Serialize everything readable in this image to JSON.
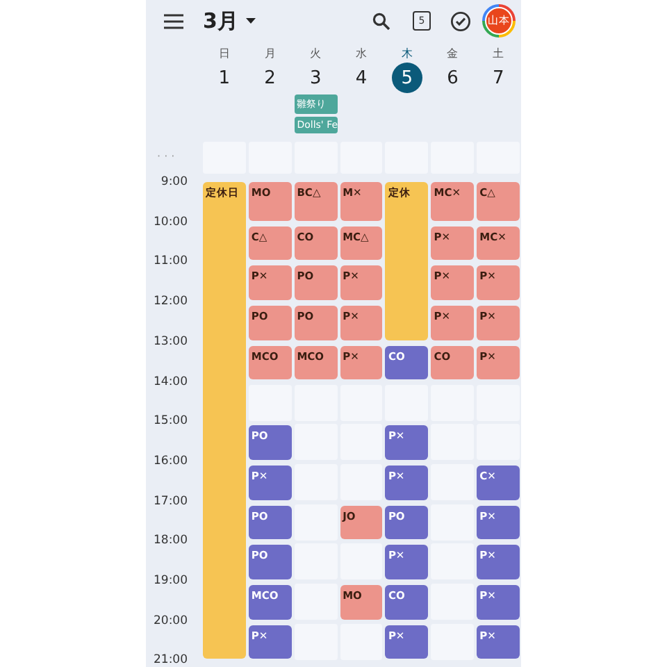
{
  "header": {
    "month": "3月",
    "calendar_day": "5",
    "avatar": "山本"
  },
  "collapsed_label": "· · ·",
  "hours": [
    "9:00",
    "10:00",
    "11:00",
    "12:00",
    "13:00",
    "14:00",
    "15:00",
    "16:00",
    "17:00",
    "18:00",
    "19:00",
    "20:00",
    "21:00"
  ],
  "days": [
    {
      "weekday": "日",
      "date": "1",
      "selected": false,
      "cells": [
        {
          "kind": "event",
          "title": "定休日",
          "color": "#f6c453"
        },
        {
          "kind": "continued"
        },
        {
          "kind": "continued"
        },
        {
          "kind": "continued"
        },
        {
          "kind": "continued"
        },
        {
          "kind": "continued"
        },
        {
          "kind": "continued"
        },
        {
          "kind": "continued"
        },
        {
          "kind": "continued"
        },
        {
          "kind": "continued"
        },
        {
          "kind": "continued"
        },
        {
          "kind": "continued"
        }
      ]
    },
    {
      "weekday": "月",
      "date": "2",
      "selected": false,
      "cells": [
        {
          "kind": "event",
          "title": "MO",
          "color": "#ec948b"
        },
        {
          "kind": "event",
          "title": "C△",
          "color": "#ec948b"
        },
        {
          "kind": "event",
          "title": "P✕",
          "color": "#ec948b"
        },
        {
          "kind": "event",
          "title": "PO",
          "color": "#ec948b"
        },
        {
          "kind": "event",
          "title": "MCO",
          "color": "#ec948b"
        },
        {
          "kind": "empty"
        },
        {
          "kind": "event",
          "title": "PO",
          "color": "#6d6cc6"
        },
        {
          "kind": "event",
          "title": "P✕",
          "color": "#6d6cc6"
        },
        {
          "kind": "event",
          "title": "PO",
          "color": "#6d6cc6"
        },
        {
          "kind": "event",
          "title": "PO",
          "color": "#6d6cc6"
        },
        {
          "kind": "event",
          "title": "MCO",
          "color": "#6d6cc6"
        },
        {
          "kind": "event",
          "title": "P✕",
          "color": "#6d6cc6"
        }
      ]
    },
    {
      "weekday": "火",
      "date": "3",
      "selected": false,
      "all_day": [
        {
          "title": "雛祭り"
        },
        {
          "title": "Dolls' Fe"
        }
      ],
      "cells": [
        {
          "kind": "event",
          "title": "BC△",
          "color": "#ec948b"
        },
        {
          "kind": "event",
          "title": "CO",
          "color": "#ec948b"
        },
        {
          "kind": "event",
          "title": "PO",
          "color": "#ec948b"
        },
        {
          "kind": "event",
          "title": "PO",
          "color": "#ec948b"
        },
        {
          "kind": "event",
          "title": "MCO",
          "color": "#ec948b"
        },
        {
          "kind": "empty"
        },
        {
          "kind": "empty"
        },
        {
          "kind": "empty"
        },
        {
          "kind": "empty"
        },
        {
          "kind": "empty"
        },
        {
          "kind": "empty"
        },
        {
          "kind": "empty"
        }
      ]
    },
    {
      "weekday": "水",
      "date": "4",
      "selected": false,
      "cells": [
        {
          "kind": "event",
          "title": "M✕",
          "color": "#ec948b"
        },
        {
          "kind": "event",
          "title": "MC△",
          "color": "#ec948b"
        },
        {
          "kind": "event",
          "title": "P✕",
          "color": "#ec948b"
        },
        {
          "kind": "event",
          "title": "P✕",
          "color": "#ec948b"
        },
        {
          "kind": "event",
          "title": "P✕",
          "color": "#ec948b"
        },
        {
          "kind": "empty"
        },
        {
          "kind": "empty"
        },
        {
          "kind": "empty"
        },
        {
          "kind": "event",
          "title": "JO",
          "color": "#ec948b"
        },
        {
          "kind": "empty"
        },
        {
          "kind": "event",
          "title": "MO",
          "color": "#ec948b"
        },
        {
          "kind": "empty"
        }
      ]
    },
    {
      "weekday": "木",
      "date": "5",
      "selected": true,
      "cells": [
        {
          "kind": "event",
          "title": "定休",
          "color": "#f6c453"
        },
        {
          "kind": "continued"
        },
        {
          "kind": "continued"
        },
        {
          "kind": "continued"
        },
        {
          "kind": "event",
          "title": "CO",
          "color": "#6d6cc6"
        },
        {
          "kind": "empty"
        },
        {
          "kind": "event",
          "title": "P✕",
          "color": "#6d6cc6"
        },
        {
          "kind": "event",
          "title": "P✕",
          "color": "#6d6cc6"
        },
        {
          "kind": "event",
          "title": "PO",
          "color": "#6d6cc6"
        },
        {
          "kind": "event",
          "title": "P✕",
          "color": "#6d6cc6"
        },
        {
          "kind": "event",
          "title": "CO",
          "color": "#6d6cc6"
        },
        {
          "kind": "event",
          "title": "P✕",
          "color": "#6d6cc6"
        }
      ]
    },
    {
      "weekday": "金",
      "date": "6",
      "selected": false,
      "cells": [
        {
          "kind": "event",
          "title": "MC✕",
          "color": "#ec948b"
        },
        {
          "kind": "event",
          "title": "P✕",
          "color": "#ec948b"
        },
        {
          "kind": "event",
          "title": "P✕",
          "color": "#ec948b"
        },
        {
          "kind": "event",
          "title": "P✕",
          "color": "#ec948b"
        },
        {
          "kind": "event",
          "title": "CO",
          "color": "#ec948b"
        },
        {
          "kind": "empty"
        },
        {
          "kind": "empty"
        },
        {
          "kind": "empty"
        },
        {
          "kind": "empty"
        },
        {
          "kind": "empty"
        },
        {
          "kind": "empty"
        },
        {
          "kind": "empty"
        }
      ]
    },
    {
      "weekday": "土",
      "date": "7",
      "selected": false,
      "cells": [
        {
          "kind": "event",
          "title": "C△",
          "color": "#ec948b"
        },
        {
          "kind": "event",
          "title": "MC✕",
          "color": "#ec948b"
        },
        {
          "kind": "event",
          "title": "P✕",
          "color": "#ec948b"
        },
        {
          "kind": "event",
          "title": "P✕",
          "color": "#ec948b"
        },
        {
          "kind": "event",
          "title": "P✕",
          "color": "#ec948b"
        },
        {
          "kind": "empty"
        },
        {
          "kind": "empty"
        },
        {
          "kind": "event",
          "title": "C✕",
          "color": "#6d6cc6"
        },
        {
          "kind": "event",
          "title": "P✕",
          "color": "#6d6cc6"
        },
        {
          "kind": "event",
          "title": "P✕",
          "color": "#6d6cc6"
        },
        {
          "kind": "event",
          "title": "P✕",
          "color": "#6d6cc6"
        },
        {
          "kind": "event",
          "title": "P✕",
          "color": "#6d6cc6"
        }
      ]
    }
  ]
}
